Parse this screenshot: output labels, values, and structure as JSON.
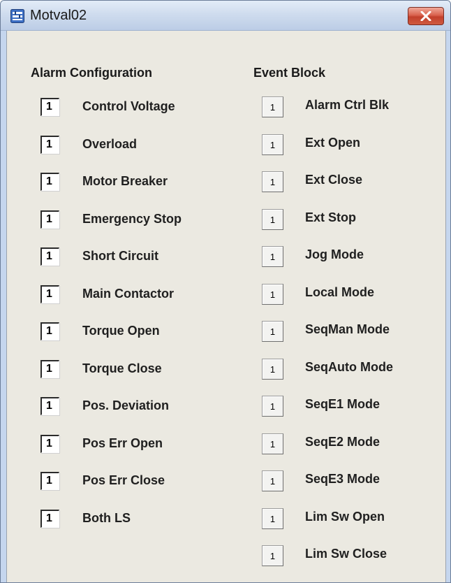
{
  "window": {
    "title": "Motval02"
  },
  "alarm_configuration": {
    "header": "Alarm Configuration",
    "items": [
      {
        "value": "1",
        "label": "Control Voltage"
      },
      {
        "value": "1",
        "label": "Overload"
      },
      {
        "value": "1",
        "label": "Motor Breaker"
      },
      {
        "value": "1",
        "label": "Emergency Stop"
      },
      {
        "value": "1",
        "label": "Short Circuit"
      },
      {
        "value": "1",
        "label": "Main Contactor"
      },
      {
        "value": "1",
        "label": "Torque Open"
      },
      {
        "value": "1",
        "label": "Torque Close"
      },
      {
        "value": "1",
        "label": "Pos. Deviation"
      },
      {
        "value": "1",
        "label": "Pos Err Open"
      },
      {
        "value": "1",
        "label": "Pos Err Close"
      },
      {
        "value": "1",
        "label": "Both LS"
      }
    ]
  },
  "event_block": {
    "header": "Event Block",
    "items": [
      {
        "value": "1",
        "label": "Alarm Ctrl Blk"
      },
      {
        "value": "1",
        "label": "Ext Open"
      },
      {
        "value": "1",
        "label": "Ext Close"
      },
      {
        "value": "1",
        "label": "Ext Stop"
      },
      {
        "value": "1",
        "label": "Jog Mode"
      },
      {
        "value": "1",
        "label": "Local Mode"
      },
      {
        "value": "1",
        "label": "SeqMan Mode"
      },
      {
        "value": "1",
        "label": "SeqAuto Mode"
      },
      {
        "value": "1",
        "label": "SeqE1 Mode"
      },
      {
        "value": "1",
        "label": "SeqE2 Mode"
      },
      {
        "value": "1",
        "label": "SeqE3 Mode"
      },
      {
        "value": "1",
        "label": "Lim Sw Open"
      },
      {
        "value": "1",
        "label": "Lim Sw Close"
      }
    ]
  },
  "icons": {
    "app": "faceplate-window-icon",
    "close": "close-icon"
  },
  "colors": {
    "close_button": "#c2402b",
    "panel_background": "#ebe9e1",
    "titlebar": "#cfdcee"
  }
}
